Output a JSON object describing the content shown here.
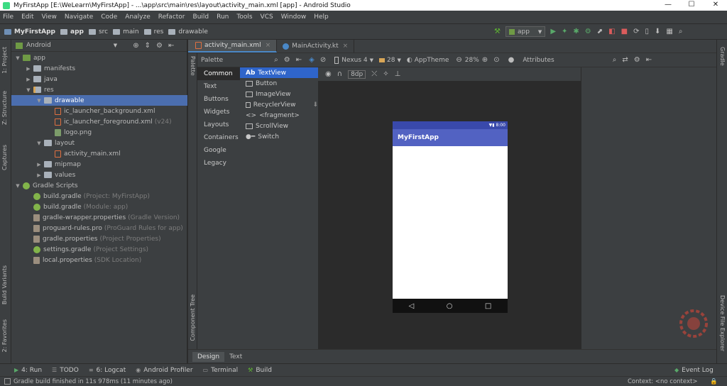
{
  "window": {
    "title": "MyFirstApp [E:\\WeLearn\\MyFirstApp] - ...\\app\\src\\main\\res\\layout\\activity_main.xml [app] - Android Studio",
    "minimize": "—",
    "maximize": "☐",
    "close": "✕"
  },
  "menu": [
    "File",
    "Edit",
    "View",
    "Navigate",
    "Code",
    "Analyze",
    "Refactor",
    "Build",
    "Run",
    "Tools",
    "VCS",
    "Window",
    "Help"
  ],
  "breadcrumb": [
    "MyFirstApp",
    "app",
    "src",
    "main",
    "res",
    "drawable"
  ],
  "run_config": "app",
  "left_tabs": {
    "project": "1: Project",
    "structure": "Z: Structure",
    "captures": "Captures",
    "build_variants": "Build Variants",
    "favorites": "2: Favorites"
  },
  "right_tabs": {
    "gradle": "Gradle",
    "device_explorer": "Device File Explorer"
  },
  "project": {
    "view": "Android",
    "tree": [
      {
        "label": "app",
        "hint": "",
        "icon": "app",
        "arrow": "▼",
        "indent": 0,
        "selected": false
      },
      {
        "label": "manifests",
        "hint": "",
        "icon": "folder",
        "arrow": "▶",
        "indent": 1,
        "selected": false
      },
      {
        "label": "java",
        "hint": "",
        "icon": "folder",
        "arrow": "▶",
        "indent": 1,
        "selected": false
      },
      {
        "label": "res",
        "hint": "",
        "icon": "res",
        "arrow": "▼",
        "indent": 1,
        "selected": false
      },
      {
        "label": "drawable",
        "hint": "",
        "icon": "folder",
        "arrow": "▼",
        "indent": 2,
        "selected": true
      },
      {
        "label": "ic_launcher_background.xml",
        "hint": "",
        "icon": "xml",
        "arrow": "",
        "indent": 3,
        "selected": false
      },
      {
        "label": "ic_launcher_foreground.xml",
        "hint": "(v24)",
        "icon": "xml",
        "arrow": "",
        "indent": 3,
        "selected": false
      },
      {
        "label": "logo.png",
        "hint": "",
        "icon": "img",
        "arrow": "",
        "indent": 3,
        "selected": false
      },
      {
        "label": "layout",
        "hint": "",
        "icon": "folder",
        "arrow": "▼",
        "indent": 2,
        "selected": false
      },
      {
        "label": "activity_main.xml",
        "hint": "",
        "icon": "xml",
        "arrow": "",
        "indent": 3,
        "selected": false
      },
      {
        "label": "mipmap",
        "hint": "",
        "icon": "folder",
        "arrow": "▶",
        "indent": 2,
        "selected": false
      },
      {
        "label": "values",
        "hint": "",
        "icon": "folder",
        "arrow": "▶",
        "indent": 2,
        "selected": false
      },
      {
        "label": "Gradle Scripts",
        "hint": "",
        "icon": "gradle",
        "arrow": "▼",
        "indent": 0,
        "selected": false
      },
      {
        "label": "build.gradle",
        "hint": "(Project: MyFirstApp)",
        "icon": "gradle",
        "arrow": "",
        "indent": 1,
        "selected": false
      },
      {
        "label": "build.gradle",
        "hint": "(Module: app)",
        "icon": "gradle",
        "arrow": "",
        "indent": 1,
        "selected": false
      },
      {
        "label": "gradle-wrapper.properties",
        "hint": "(Gradle Version)",
        "icon": "prop",
        "arrow": "",
        "indent": 1,
        "selected": false
      },
      {
        "label": "proguard-rules.pro",
        "hint": "(ProGuard Rules for app)",
        "icon": "prop",
        "arrow": "",
        "indent": 1,
        "selected": false
      },
      {
        "label": "gradle.properties",
        "hint": "(Project Properties)",
        "icon": "prop",
        "arrow": "",
        "indent": 1,
        "selected": false
      },
      {
        "label": "settings.gradle",
        "hint": "(Project Settings)",
        "icon": "gradle",
        "arrow": "",
        "indent": 1,
        "selected": false
      },
      {
        "label": "local.properties",
        "hint": "(SDK Location)",
        "icon": "prop",
        "arrow": "",
        "indent": 1,
        "selected": false
      }
    ]
  },
  "editor_tabs": [
    {
      "label": "activity_main.xml",
      "active": true
    },
    {
      "label": "MainActivity.kt",
      "active": false
    }
  ],
  "palette": {
    "title": "Palette",
    "side_label": "Palette",
    "component_tree_label": "Component Tree",
    "categories": [
      "Common",
      "Text",
      "Buttons",
      "Widgets",
      "Layouts",
      "Containers",
      "Google",
      "Legacy"
    ],
    "items": [
      {
        "prefix": "Ab",
        "label": "TextView",
        "selected": true
      },
      {
        "prefix": "",
        "label": "Button",
        "selected": false
      },
      {
        "prefix": "",
        "label": "ImageView",
        "selected": false
      },
      {
        "prefix": "",
        "label": "RecyclerView",
        "selected": false
      },
      {
        "prefix": "<>",
        "label": "<fragment>",
        "selected": false
      },
      {
        "prefix": "",
        "label": "ScrollView",
        "selected": false
      },
      {
        "prefix": "",
        "label": "Switch",
        "selected": false
      }
    ]
  },
  "design_toolbar": {
    "device": "Nexus 4",
    "api": "28",
    "theme": "AppTheme",
    "zoom": "28%",
    "margin": "8dp"
  },
  "attributes_title": "Attributes",
  "phone": {
    "app_title": "MyFirstApp",
    "time": "8:00"
  },
  "bottom_tabs": [
    "Design",
    "Text"
  ],
  "tool_windows": [
    {
      "icon": "▶",
      "label": "4: Run"
    },
    {
      "icon": "☰",
      "label": "TODO"
    },
    {
      "icon": "≡",
      "label": "6: Logcat"
    },
    {
      "icon": "◉",
      "label": "Android Profiler"
    },
    {
      "icon": "▭",
      "label": "Terminal"
    },
    {
      "icon": "⚒",
      "label": "Build"
    }
  ],
  "event_log": "Event Log",
  "status": {
    "message": "Gradle build finished in 11s 978ms (11 minutes ago)",
    "context": "Context: <no context>"
  },
  "colors": {
    "selection": "#4b6eaf",
    "palette_selection": "#2f65ca",
    "phone_appbar": "#5262c2",
    "phone_status": "#3949ab"
  }
}
